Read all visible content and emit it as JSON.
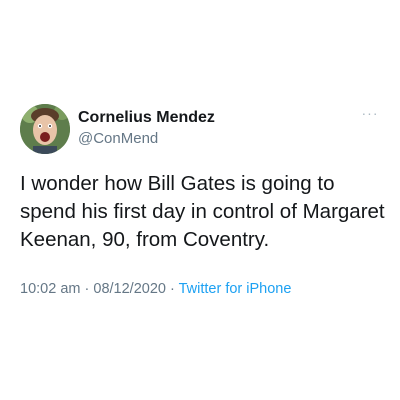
{
  "tweet": {
    "author_name": "Cornelius Mendez",
    "author_handle": "@ConMend",
    "text": "I wonder how Bill Gates is going to spend his first day in control of Margaret Keenan, 90, from Coventry.",
    "time": "10:02 am",
    "separator": "·",
    "date": "08/12/2020",
    "source": "Twitter for iPhone",
    "more_icon": "more-options-icon",
    "more_glyph": "···"
  },
  "colors": {
    "name": "#14171a",
    "secondary": "#657786",
    "link": "#1da1f2",
    "background": "#ffffff"
  }
}
